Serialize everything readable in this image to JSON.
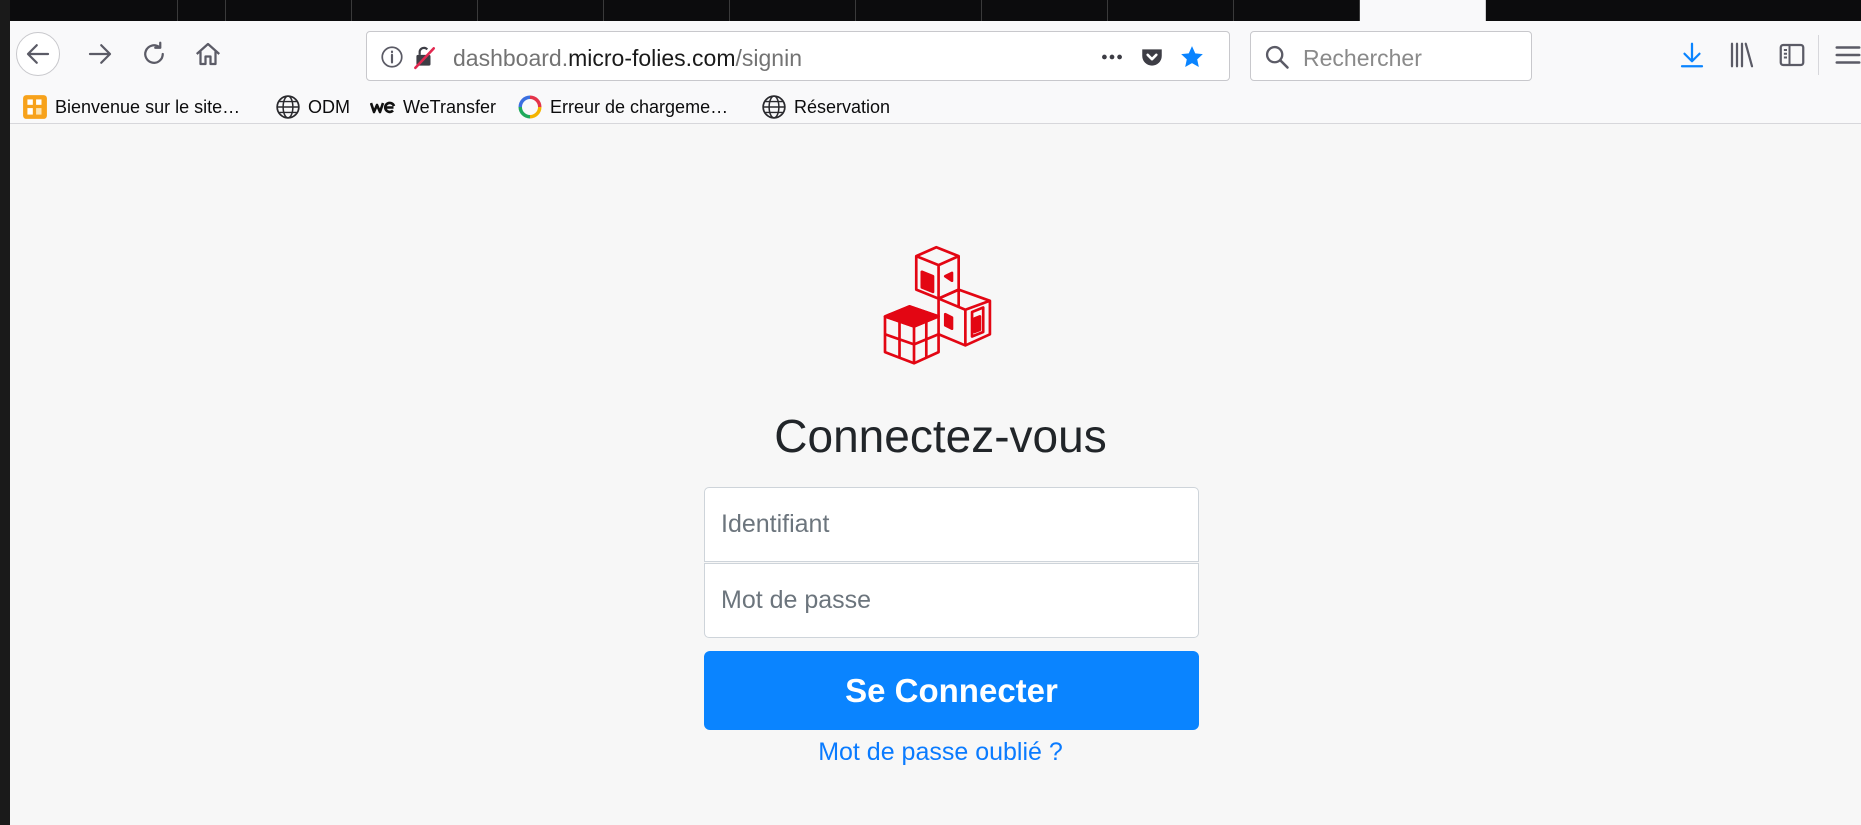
{
  "browser": {
    "url_prefix": "dashboard.",
    "url_host": "micro-folies.com",
    "url_path": "/signin",
    "search_placeholder": "Rechercher",
    "accent": "#0a84ff"
  },
  "bookmarks": [
    {
      "label": "Bienvenue sur le site…",
      "icon": "site-favicon-icon"
    },
    {
      "label": "ODM",
      "icon": "globe-icon"
    },
    {
      "label": "WeTransfer",
      "icon": "wetransfer-icon"
    },
    {
      "label": "Erreur de chargeme…",
      "icon": "loading-ring-icon"
    },
    {
      "label": "Réservation",
      "icon": "globe-icon"
    }
  ],
  "login": {
    "title": "Connectez-vous",
    "username_placeholder": "Identifiant",
    "password_placeholder": "Mot de passe",
    "submit_label": "Se Connecter",
    "forgot_label": "Mot de passe oublié ?",
    "logo_color": "#e30613",
    "button_color": "#0a84ff"
  }
}
